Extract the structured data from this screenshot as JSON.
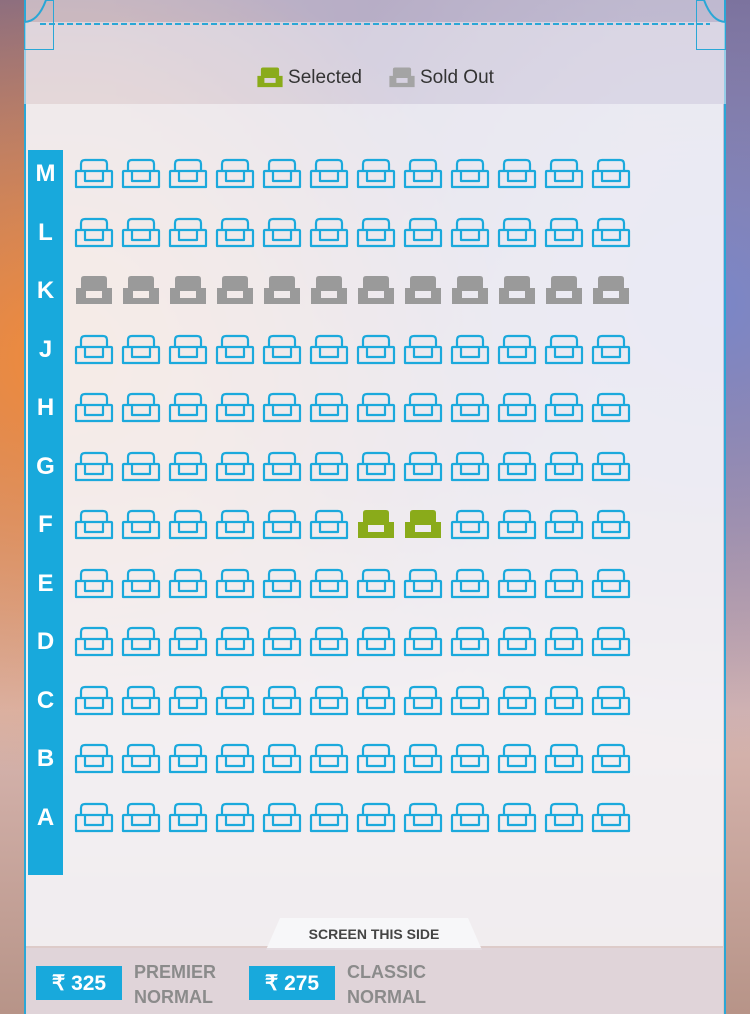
{
  "legend": {
    "selected_label": "Selected",
    "soldout_label": "Sold Out"
  },
  "colors": {
    "available": "#1ba9dc",
    "selected": "#8aab1a",
    "soldout": "#9a9a9a",
    "row_bar": "#18a9dc"
  },
  "rows": [
    {
      "label": "M",
      "seats": [
        "available",
        "available",
        "available",
        "available",
        "available",
        "available",
        "available",
        "available",
        "available",
        "available",
        "available",
        "available"
      ]
    },
    {
      "label": "L",
      "seats": [
        "available",
        "available",
        "available",
        "available",
        "available",
        "available",
        "available",
        "available",
        "available",
        "available",
        "available",
        "available"
      ]
    },
    {
      "label": "K",
      "seats": [
        "soldout",
        "soldout",
        "soldout",
        "soldout",
        "soldout",
        "soldout",
        "soldout",
        "soldout",
        "soldout",
        "soldout",
        "soldout",
        "soldout"
      ]
    },
    {
      "label": "J",
      "seats": [
        "available",
        "available",
        "available",
        "available",
        "available",
        "available",
        "available",
        "available",
        "available",
        "available",
        "available",
        "available"
      ]
    },
    {
      "label": "H",
      "seats": [
        "available",
        "available",
        "available",
        "available",
        "available",
        "available",
        "available",
        "available",
        "available",
        "available",
        "available",
        "available"
      ]
    },
    {
      "label": "G",
      "seats": [
        "available",
        "available",
        "available",
        "available",
        "available",
        "available",
        "available",
        "available",
        "available",
        "available",
        "available",
        "available"
      ]
    },
    {
      "label": "F",
      "seats": [
        "available",
        "available",
        "available",
        "available",
        "available",
        "available",
        "selected",
        "selected",
        "available",
        "available",
        "available",
        "available"
      ]
    },
    {
      "label": "E",
      "seats": [
        "available",
        "available",
        "available",
        "available",
        "available",
        "available",
        "available",
        "available",
        "available",
        "available",
        "available",
        "available"
      ]
    },
    {
      "label": "D",
      "seats": [
        "available",
        "available",
        "available",
        "available",
        "available",
        "available",
        "available",
        "available",
        "available",
        "available",
        "available",
        "available"
      ]
    },
    {
      "label": "C",
      "seats": [
        "available",
        "available",
        "available",
        "available",
        "available",
        "available",
        "available",
        "available",
        "available",
        "available",
        "available",
        "available"
      ]
    },
    {
      "label": "B",
      "seats": [
        "available",
        "available",
        "available",
        "available",
        "available",
        "available",
        "available",
        "available",
        "available",
        "available",
        "available",
        "available"
      ]
    },
    {
      "label": "A",
      "seats": [
        "available",
        "available",
        "available",
        "available",
        "available",
        "available",
        "available",
        "available",
        "available",
        "available",
        "available",
        "available"
      ]
    }
  ],
  "screen_label": "SCREEN THIS SIDE",
  "prices": [
    {
      "amount": "₹ 325",
      "category_line1": "PREMIER",
      "category_line2": "NORMAL"
    },
    {
      "amount": "₹ 275",
      "category_line1": "CLASSIC",
      "category_line2": "NORMAL"
    }
  ]
}
